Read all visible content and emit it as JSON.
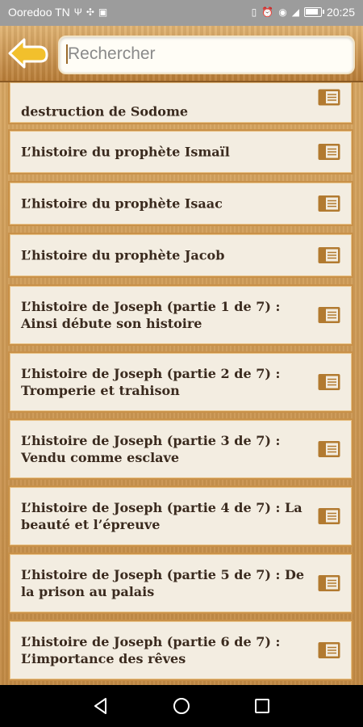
{
  "status_bar": {
    "carrier": "Ooredoo TN",
    "time": "20:25"
  },
  "search": {
    "placeholder": "Rechercher",
    "value": ""
  },
  "icons": {
    "back": "back-arrow-icon",
    "item": "book-icon"
  },
  "colors": {
    "wood": "#c9954e",
    "card": "#f3ede1",
    "border": "#c99149",
    "text": "#3a2a1e",
    "back_arrow": "#f2c02c"
  },
  "items": [
    {
      "title": "destruction de Sodome"
    },
    {
      "title": "L’histoire du prophète Ismaïl"
    },
    {
      "title": "L’histoire du prophète Isaac"
    },
    {
      "title": "L’histoire du prophète Jacob"
    },
    {
      "title": "L’histoire de Joseph (partie 1 de 7) : Ainsi débute son histoire"
    },
    {
      "title": "L’histoire de Joseph (partie 2 de 7) : Tromperie et trahison"
    },
    {
      "title": "L’histoire de Joseph (partie 3 de 7) : Vendu comme esclave"
    },
    {
      "title": "L’histoire de Joseph (partie 4 de 7) : La beauté et l’épreuve"
    },
    {
      "title": "L’histoire de Joseph (partie 5 de 7) : De la prison au palais"
    },
    {
      "title": "L’histoire de Joseph (partie 6 de 7) : L’importance des rêves"
    }
  ]
}
